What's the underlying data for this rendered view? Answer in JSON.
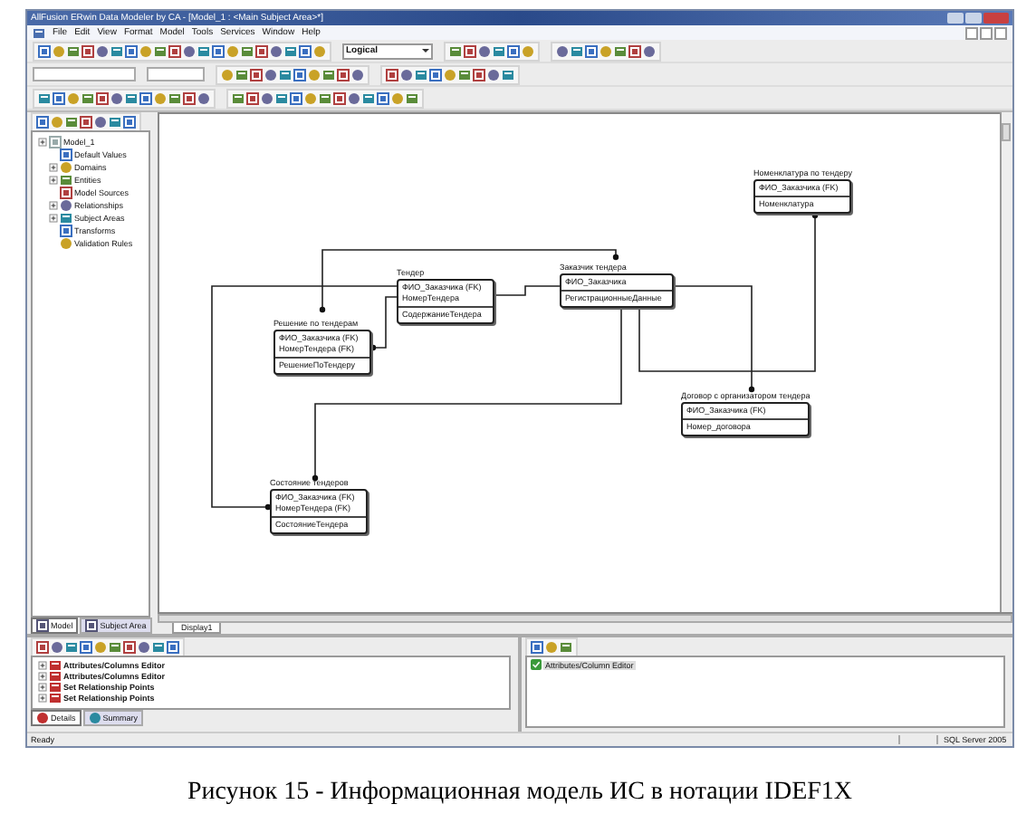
{
  "window": {
    "title": "AllFusion ERwin Data Modeler by CA - [Model_1 : <Main Subject Area>*]"
  },
  "menu": [
    "File",
    "Edit",
    "View",
    "Format",
    "Model",
    "Tools",
    "Services",
    "Window",
    "Help"
  ],
  "view_mode": {
    "value": "Logical"
  },
  "model_tree": {
    "label": "Model_1",
    "children": [
      {
        "label": "Default Values",
        "expandable": false
      },
      {
        "label": "Domains",
        "expandable": true
      },
      {
        "label": "Entities",
        "expandable": true
      },
      {
        "label": "Model Sources",
        "expandable": false
      },
      {
        "label": "Relationships",
        "expandable": true
      },
      {
        "label": "Subject Areas",
        "expandable": true
      },
      {
        "label": "Transforms",
        "expandable": false
      },
      {
        "label": "Validation Rules",
        "expandable": false
      }
    ]
  },
  "explorer_tabs": [
    {
      "label": "Model",
      "selected": true
    },
    {
      "label": "Subject Area",
      "selected": false
    }
  ],
  "diagram": {
    "entities": [
      {
        "name": "Номенклатура по тендеру",
        "keys": [
          "ФИО_Заказчика (FK)"
        ],
        "attributes": [
          "Номенклатура"
        ]
      },
      {
        "name": "Тендер",
        "keys": [
          "ФИО_Заказчика (FK)",
          "НомерТендера"
        ],
        "attributes": [
          "СодержаниеТендера"
        ]
      },
      {
        "name": "Заказчик тендера",
        "keys": [
          "ФИО_Заказчика"
        ],
        "attributes": [
          "РегистрационныеДанные"
        ]
      },
      {
        "name": "Решение по тендерам",
        "keys": [
          "ФИО_Заказчика (FK)",
          "НомерТендера (FK)"
        ],
        "attributes": [
          "РешениеПоТендеру"
        ]
      },
      {
        "name": "Договор с организатором тендера",
        "keys": [
          "ФИО_Заказчика (FK)"
        ],
        "attributes": [
          "Номер_договора"
        ]
      },
      {
        "name": "Состояние тендеров",
        "keys": [
          "ФИО_Заказчика (FK)",
          "НомерТендера (FK)"
        ],
        "attributes": [
          "СостояниеТендера"
        ]
      }
    ],
    "tabs": [
      {
        "label": "Display1",
        "selected": true
      }
    ]
  },
  "action_log": {
    "items": [
      {
        "label": "Attributes/Columns Editor",
        "expandable": true
      },
      {
        "label": "Attributes/Columns Editor",
        "expandable": true
      },
      {
        "label": "Set Relationship Points",
        "expandable": true
      },
      {
        "label": "Set Relationship Points",
        "expandable": true
      }
    ],
    "tabs": [
      {
        "label": "Details",
        "selected": true
      },
      {
        "label": "Summary",
        "selected": false
      }
    ]
  },
  "details": {
    "items": [
      "Attributes/Column Editor"
    ]
  },
  "status_bar": {
    "message": "Ready",
    "target": "SQL Server 2005"
  },
  "caption": "Рисунок 15 - Информационная модель ИС в нотации IDEF1X"
}
